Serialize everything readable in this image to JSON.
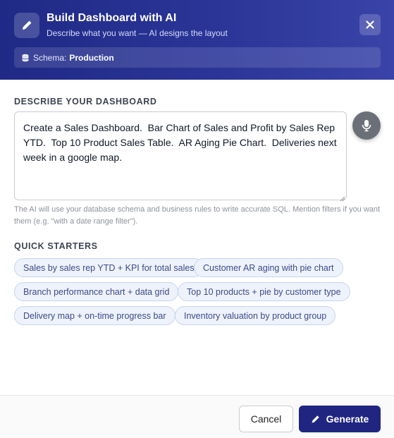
{
  "header": {
    "title": "Build Dashboard with AI",
    "subtitle": "Describe what you want — AI designs the layout",
    "icon": "pencil-icon",
    "close_icon": "close-icon"
  },
  "schema": {
    "label": "Schema:",
    "value": "Production",
    "icon": "database-icon"
  },
  "prompt": {
    "section_label": "DESCRIBE YOUR DASHBOARD",
    "value": "Create a Sales Dashboard.  Bar Chart of Sales and Profit by Sales Rep YTD.  Top 10 Product Sales Table.  AR Aging Pie Chart.  Deliveries next week in a google map.",
    "mic_icon": "microphone-icon",
    "helper": "The AI will use your database schema and business rules to write accurate SQL. Mention filters if you want them (e.g. \"with a date range filter\")."
  },
  "quick_starters": {
    "label": "QUICK STARTERS",
    "items": [
      "Sales by sales rep YTD + KPI for total sales",
      "Customer AR aging with pie chart",
      "Branch performance chart + data grid",
      "Top 10 products + pie by customer type",
      "Delivery map + on-time progress bar",
      "Inventory valuation by product group"
    ]
  },
  "footer": {
    "cancel_label": "Cancel",
    "generate_label": "Generate"
  },
  "colors": {
    "header_bg": "#23307f",
    "primary": "#1f2580",
    "chip_bg": "#eef3fb",
    "chip_text": "#3d4a8a"
  }
}
